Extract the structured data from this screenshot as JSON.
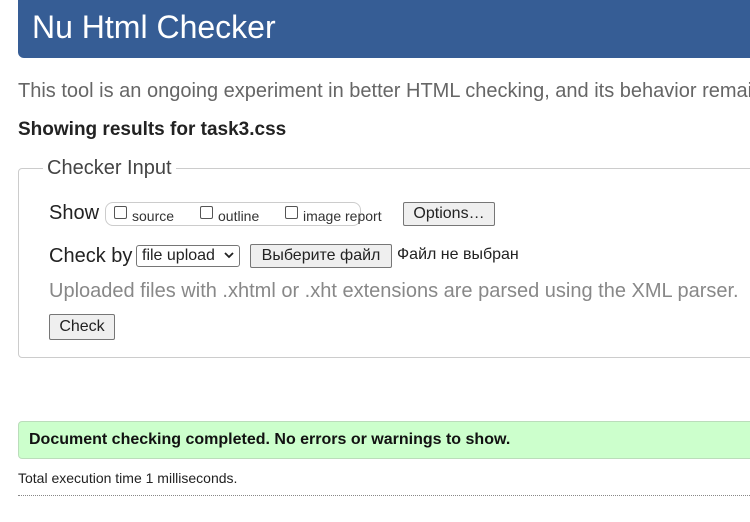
{
  "header": {
    "title": "Nu Html Checker",
    "background_color": "#365d95"
  },
  "intro": {
    "text": "This tool is an ongoing experiment in better HTML checking, and its behavior remai"
  },
  "results": {
    "heading": "Showing results for task3.css"
  },
  "checker_input": {
    "legend": "Checker Input",
    "show": {
      "label": "Show",
      "options": [
        {
          "label": "source",
          "checked": false
        },
        {
          "label": "outline",
          "checked": false
        },
        {
          "label": "image report",
          "checked": false
        }
      ],
      "options_button": "Options…"
    },
    "check_by": {
      "label": "Check by",
      "selected": "file upload",
      "choose_file_button": "Выберите файл",
      "no_file_text": "Файл не выбран"
    },
    "hint": "Uploaded files with .xhtml or .xht extensions are parsed using the XML parser.",
    "check_button": "Check"
  },
  "status": {
    "message": "Document checking completed. No errors or warnings to show.",
    "color": "#ccffcc"
  },
  "footer": {
    "execution_time": "Total execution time 1 milliseconds."
  }
}
